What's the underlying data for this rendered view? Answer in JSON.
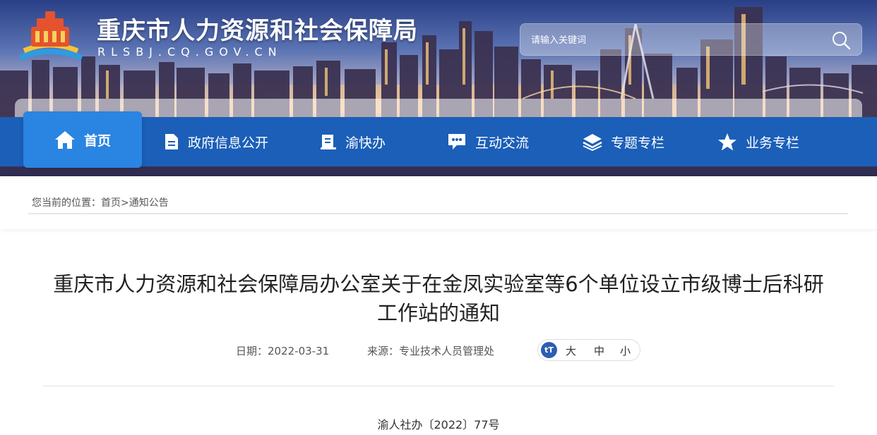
{
  "header": {
    "site_title": "重庆市人力资源和社会保障局",
    "site_domain": "RLSBJ.CQ.GOV.CN",
    "search_placeholder": "请输入关键词"
  },
  "nav": {
    "items": [
      {
        "label": "首页",
        "icon": "home-icon",
        "active": true
      },
      {
        "label": "政府信息公开",
        "icon": "document-icon"
      },
      {
        "label": "渝快办",
        "icon": "book-icon"
      },
      {
        "label": "互动交流",
        "icon": "chat-icon"
      },
      {
        "label": "专题专栏",
        "icon": "layers-icon"
      },
      {
        "label": "业务专栏",
        "icon": "star-icon"
      }
    ]
  },
  "breadcrumb": {
    "prefix": "您当前的位置：",
    "home": "首页",
    "separator": ">",
    "current": "通知公告"
  },
  "article": {
    "title_line1": "重庆市人力资源和社会保障局办公室关于在金凤实验室等6个单位设立市级博士后科研",
    "title_line2": "工作站的通知",
    "date_label": "日期：2022-03-31",
    "source_label": "来源：专业技术人员管理处",
    "font_size": {
      "icon": "tT",
      "large": "大",
      "medium": "中",
      "small": "小"
    },
    "doc_number": "渝人社办〔2022〕77号"
  },
  "colors": {
    "nav_bg": "#1b5fb8",
    "nav_active": "#2a84e2",
    "font_icon_bg": "#2d5db2"
  }
}
